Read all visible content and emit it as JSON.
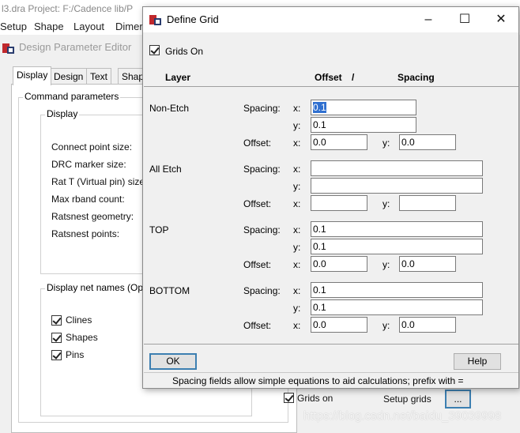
{
  "app": {
    "title": "l3.dra  Project: F:/Cadence lib/P",
    "menu": [
      "Setup",
      "Shape",
      "Layout",
      "Dimer"
    ]
  },
  "editor": {
    "title": "Design Parameter Editor",
    "tabs": [
      "Display",
      "Design",
      "Text",
      "Shap"
    ],
    "command_params_title": "Command parameters",
    "display_group_title": "Display",
    "display_rows": [
      "Connect point size:",
      "DRC marker size:",
      "Rat T (Virtual pin) size:",
      "Max rband count:",
      "Ratsnest geometry:",
      "Ratsnest points:"
    ],
    "net_names_title": "Display net names (Open",
    "net_checks": [
      "Clines",
      "Shapes",
      "Pins"
    ],
    "grids_on_label": "Grids on",
    "setup_grids_label": "Setup grids",
    "setup_grids_button": "..."
  },
  "dialog": {
    "title": "Define Grid",
    "window_buttons": [
      "–",
      "☐",
      "✕"
    ],
    "grids_on_label": "Grids On",
    "grids_on_checked": true,
    "headers": {
      "layer": "Layer",
      "offset": "Offset",
      "slash": "/",
      "spacing": "Spacing"
    },
    "labels": {
      "spacing": "Spacing:",
      "offset": "Offset:",
      "x": "x:",
      "y": "y:"
    },
    "layers": [
      {
        "name": "Non-Etch",
        "spacing_x": "0.1",
        "spacing_y": "0.1",
        "offset_x": "0.0",
        "offset_y": "0.0"
      },
      {
        "name": "All Etch",
        "spacing_x": "",
        "spacing_y": "",
        "offset_x": "",
        "offset_y": ""
      },
      {
        "name": "TOP",
        "spacing_x": "0.1",
        "spacing_y": "0.1",
        "offset_x": "0.0",
        "offset_y": "0.0"
      },
      {
        "name": "BOTTOM",
        "spacing_x": "0.1",
        "spacing_y": "0.1",
        "offset_x": "0.0",
        "offset_y": "0.0"
      }
    ],
    "ok_label": "OK",
    "help_label": "Help",
    "status": "Spacing fields allow simple equations to aid calculations; prefix with ="
  },
  "watermark": "https://blog.csdn.net/baidu_39039998",
  "colors": {
    "accent": "#3c7fb1",
    "selection": "#3070d0",
    "brand_red": "#c0282d"
  }
}
